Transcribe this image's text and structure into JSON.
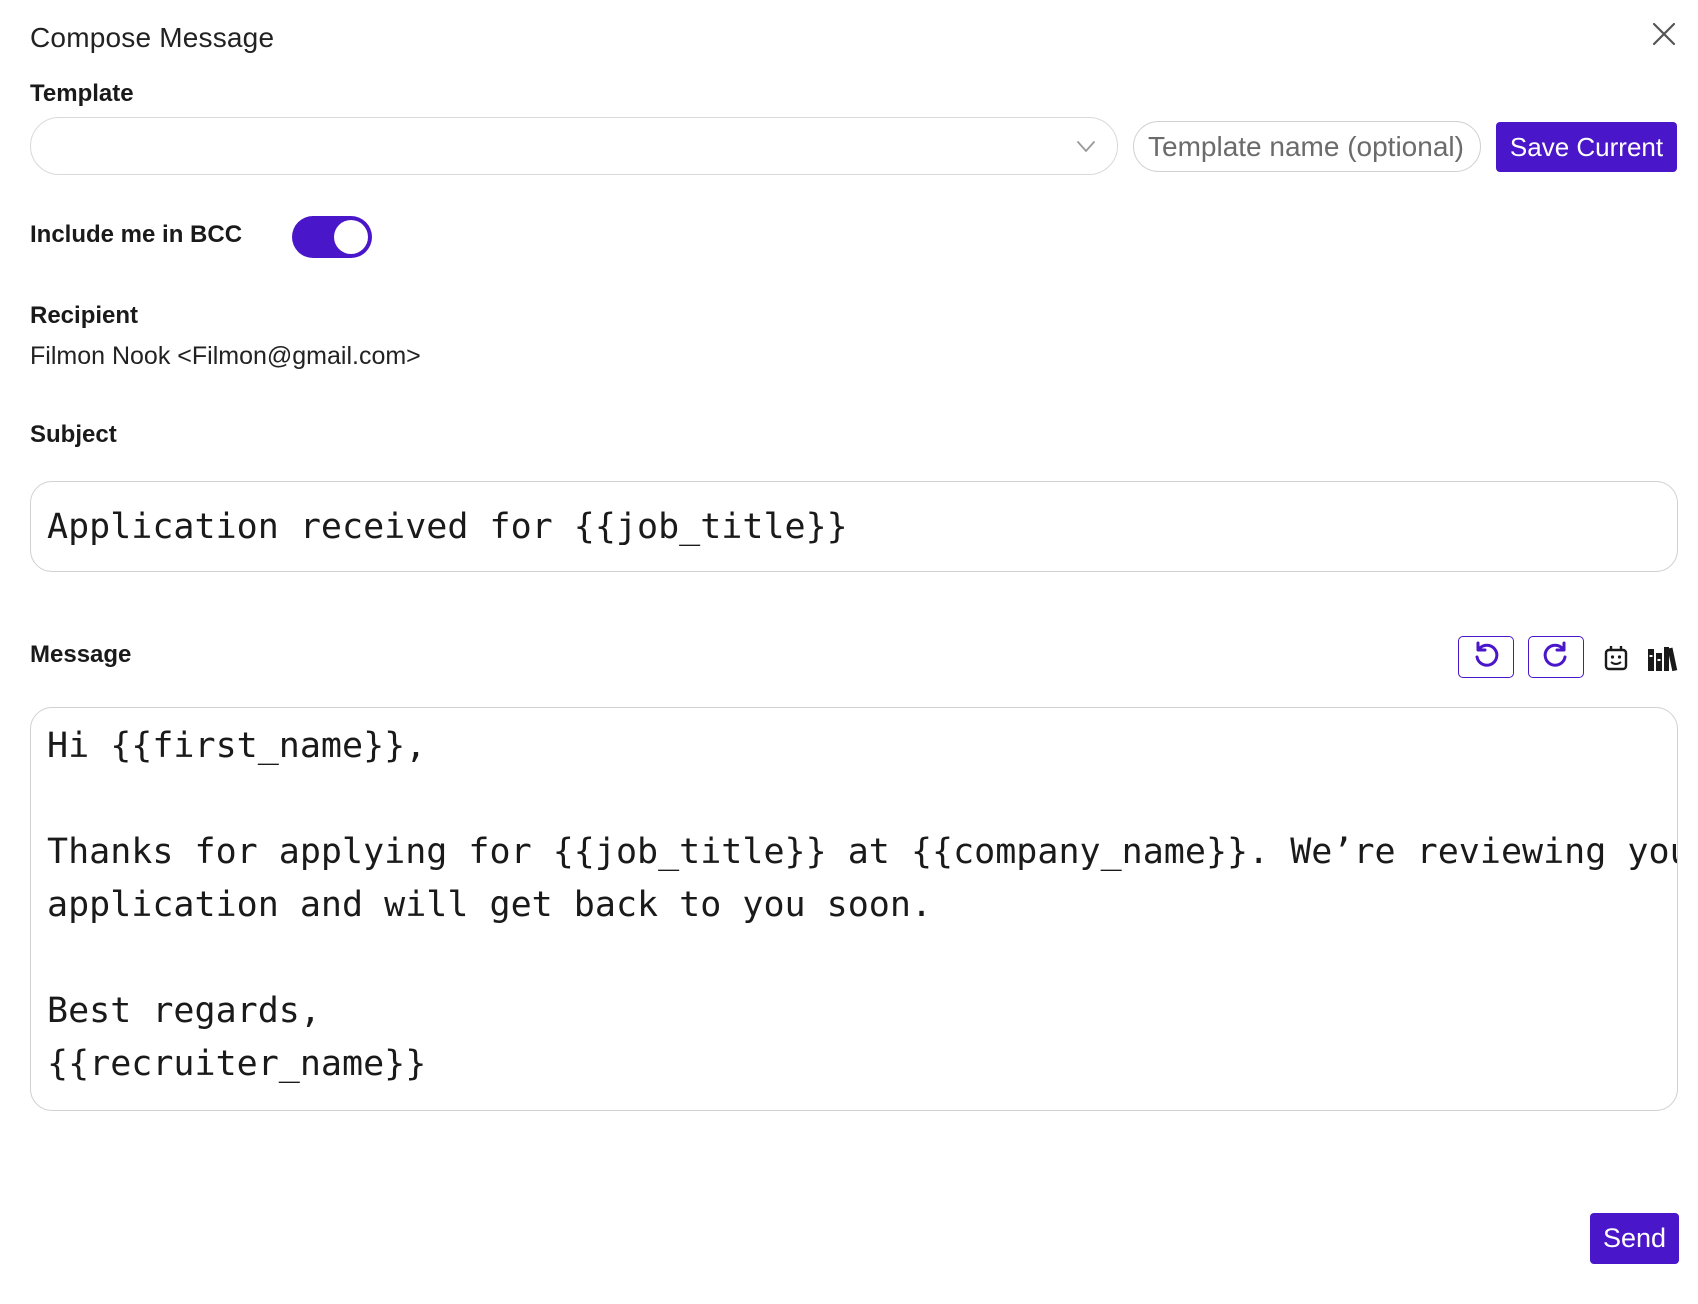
{
  "dialog": {
    "title": "Compose Message"
  },
  "template": {
    "label": "Template",
    "selected": "",
    "name_placeholder": "Template name (optional)",
    "save_label": "Save Current"
  },
  "bcc": {
    "label": "Include me in BCC",
    "enabled": true
  },
  "recipient": {
    "label": "Recipient",
    "value": "Filmon Nook <Filmon@gmail.com>"
  },
  "subject": {
    "label": "Subject",
    "value": "Application received for {{job_title}}"
  },
  "message": {
    "label": "Message",
    "toolbar": {
      "undo_icon": "undo-icon",
      "redo_icon": "redo-icon",
      "emoji_icon": "robot-face-icon",
      "library_icon": "library-icon"
    },
    "lines": {
      "l1": "Hi {{first_name}},",
      "l2": "Thanks for applying for {{job_title}} at {{company_name}}. We’re reviewing your",
      "l3": "application and will get back to you soon.",
      "l4": "Best regards,",
      "l5": "{{recruiter_name}}"
    }
  },
  "actions": {
    "send_label": "Send"
  },
  "colors": {
    "accent": "#4a16c9",
    "border": "#d0d0d0",
    "text": "#1a1a1a"
  }
}
